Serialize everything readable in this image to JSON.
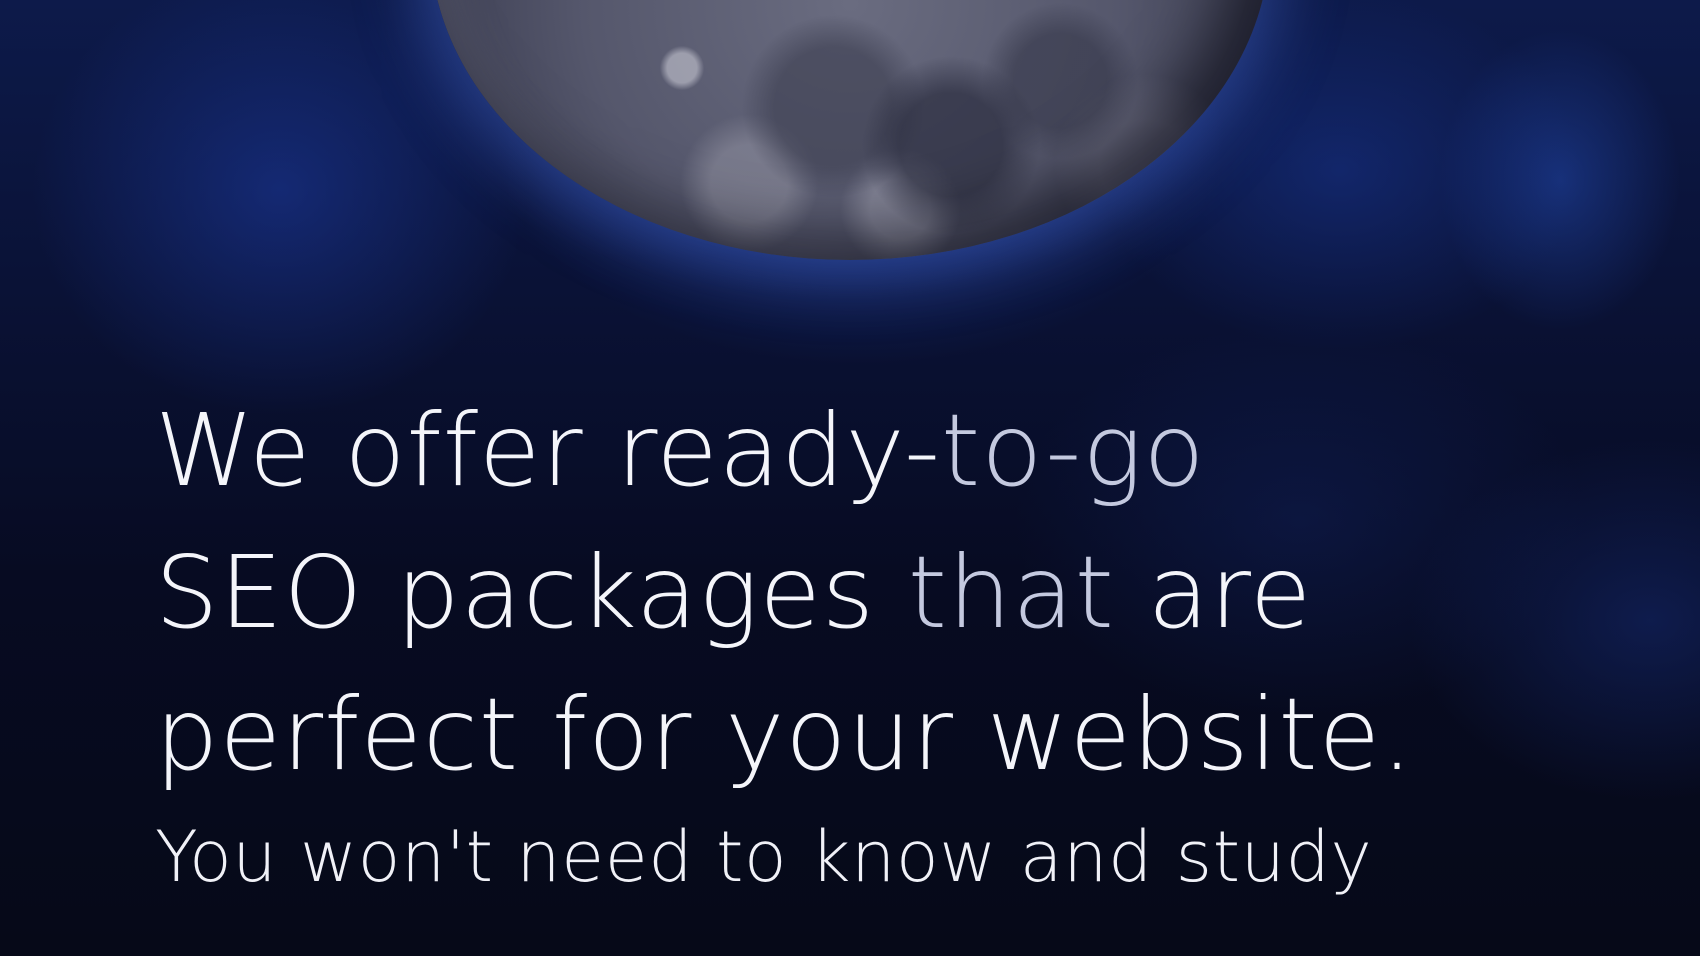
{
  "hero": {
    "headline": {
      "line1": {
        "bright": "We offer ready-",
        "dim": "to-go"
      },
      "line2": {
        "bright": "SEO packages ",
        "dim": "that",
        "bright2": " are"
      },
      "line3": {
        "bright": "perfect for your website."
      }
    },
    "subline": "You won't need to know and study"
  },
  "decor": {
    "image": "moon-image",
    "background_color": "#070b1c",
    "glow_color": "#284ebe"
  }
}
